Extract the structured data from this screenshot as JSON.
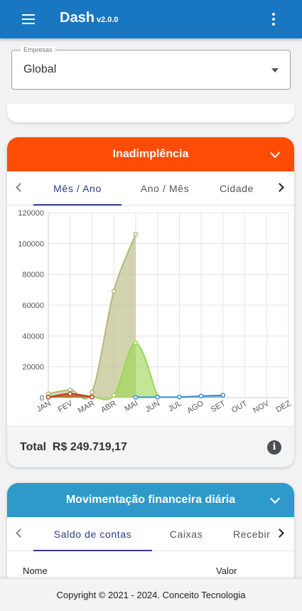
{
  "app": {
    "title": "Dash",
    "version": "v2.0.0"
  },
  "empresas": {
    "label": "Empresas",
    "value": "Global"
  },
  "inadimplencia": {
    "title": "Inadimplência",
    "tabs": [
      "Mês / Ano",
      "Ano / Mês",
      "Cidade"
    ],
    "total_label": "Total",
    "total_value": "R$ 249.719,17",
    "info_icon": "i"
  },
  "movimentacao": {
    "title": "Movimentação financeira diária",
    "tabs": [
      "Saldo de contas",
      "Caixas",
      "Recebimentos"
    ],
    "columns": [
      "Nome",
      "Valor"
    ]
  },
  "footer": {
    "text": "Copyright © 2021 - 2024. Conceito Tecnologia"
  },
  "colors": {
    "appbar": "#1976c0",
    "inadimplencia_header": "#ff4c05",
    "movimentacao_header": "#2e9ac9",
    "tab_active": "#2b3a8a"
  },
  "chart_data": {
    "type": "area",
    "categories": [
      "JAN",
      "FEV",
      "MAR",
      "ABR",
      "MAI",
      "JUN",
      "JUL",
      "AGO",
      "SET",
      "OUT",
      "NOV",
      "DEZ"
    ],
    "ylim": [
      0,
      120000
    ],
    "yticks": [
      "0",
      "20000",
      "40000",
      "60000",
      "80000",
      "100000",
      "120000"
    ],
    "grid": true,
    "series": [
      {
        "color": "#b5b87a",
        "values": [
          2500,
          5000,
          3500,
          69000,
          106000,
          null,
          null,
          null,
          null,
          null,
          null,
          null
        ]
      },
      {
        "color": "#9ad64f",
        "values": [
          500,
          1000,
          500,
          1500,
          35500,
          500,
          null,
          null,
          null,
          null,
          null,
          null
        ]
      },
      {
        "color": "#c23a1e",
        "values": [
          200,
          2500,
          400,
          null,
          null,
          null,
          null,
          null,
          null,
          null,
          null,
          null
        ]
      },
      {
        "color": "#3b8fd0",
        "values": [
          null,
          null,
          null,
          null,
          200,
          300,
          400,
          1000,
          1500,
          null,
          null,
          null
        ]
      }
    ]
  }
}
